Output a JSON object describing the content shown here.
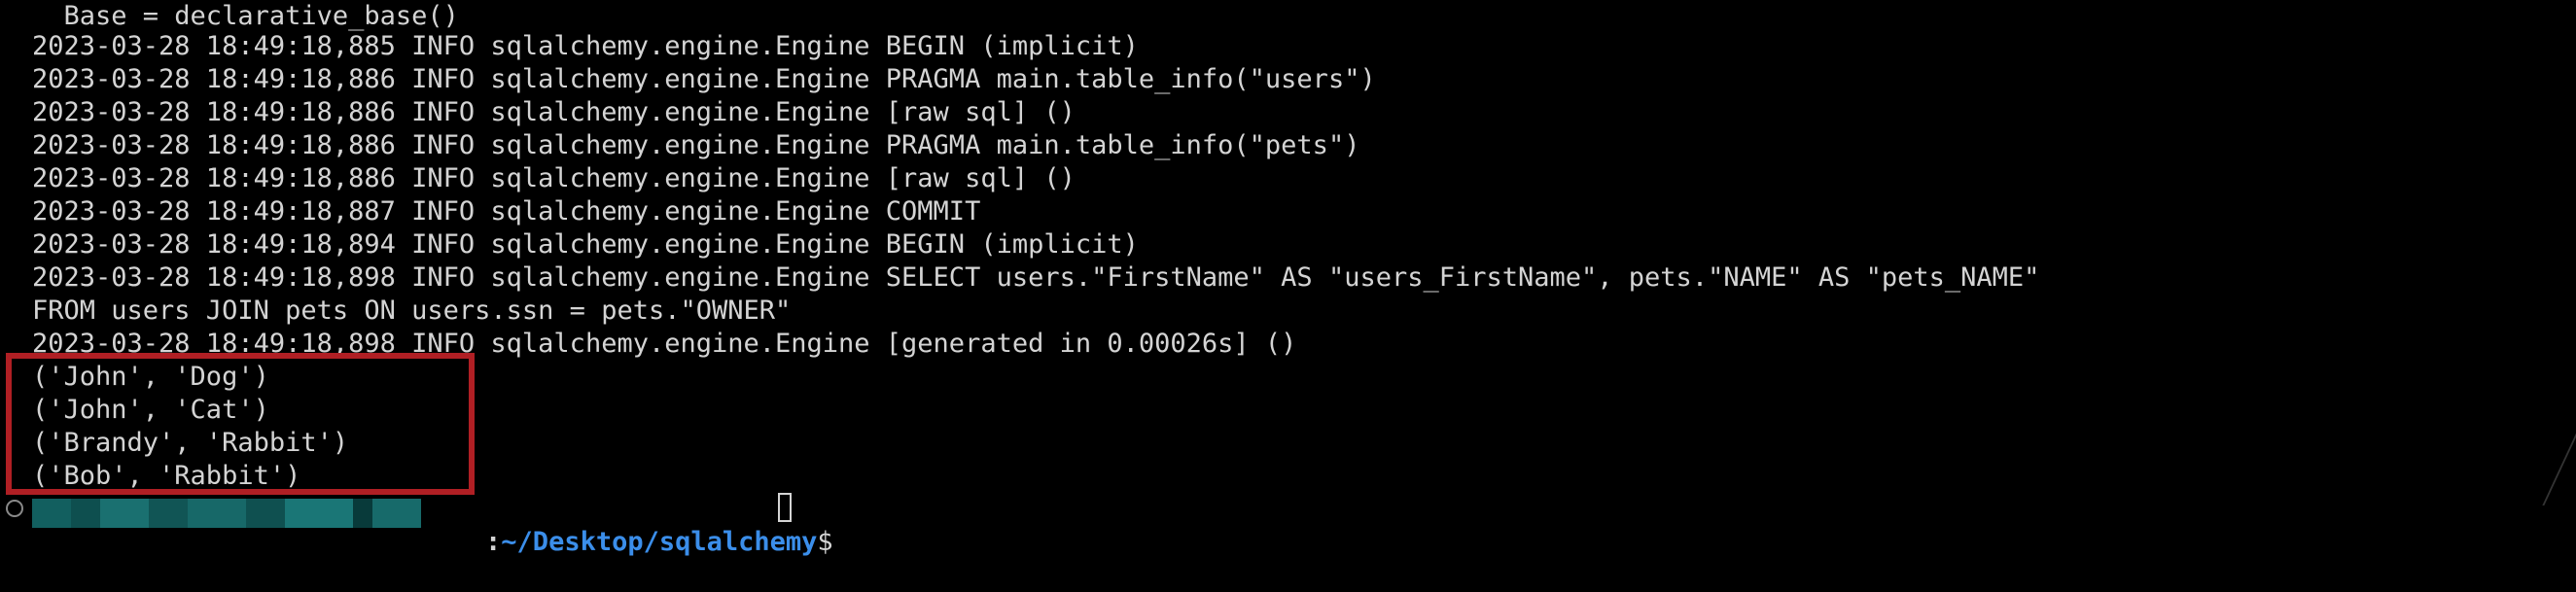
{
  "terminal": {
    "lines": [
      "  Base = declarative_base()",
      "2023-03-28 18:49:18,885 INFO sqlalchemy.engine.Engine BEGIN (implicit)",
      "2023-03-28 18:49:18,886 INFO sqlalchemy.engine.Engine PRAGMA main.table_info(\"users\")",
      "2023-03-28 18:49:18,886 INFO sqlalchemy.engine.Engine [raw sql] ()",
      "2023-03-28 18:49:18,886 INFO sqlalchemy.engine.Engine PRAGMA main.table_info(\"pets\")",
      "2023-03-28 18:49:18,886 INFO sqlalchemy.engine.Engine [raw sql] ()",
      "2023-03-28 18:49:18,887 INFO sqlalchemy.engine.Engine COMMIT",
      "2023-03-28 18:49:18,894 INFO sqlalchemy.engine.Engine BEGIN (implicit)",
      "2023-03-28 18:49:18,898 INFO sqlalchemy.engine.Engine SELECT users.\"FirstName\" AS \"users_FirstName\", pets.\"NAME\" AS \"pets_NAME\"",
      "FROM users JOIN pets ON users.ssn = pets.\"OWNER\"",
      "2023-03-28 18:49:18,898 INFO sqlalchemy.engine.Engine [generated in 0.00026s] ()",
      "('John', 'Dog')",
      "('John', 'Cat')",
      "('Brandy', 'Rabbit')",
      "('Bob', 'Rabbit')"
    ],
    "prompt": {
      "separator": ":",
      "path": "~/Desktop/sqlalchemy",
      "dollar": "$ "
    }
  },
  "colors": {
    "background": "#000000",
    "text": "#d4d4d4",
    "highlight_border": "#b01f24",
    "prompt_path": "#3b8eea",
    "redacted_block_dark": "#0f5f5f",
    "redacted_block_light": "#1a7a7a"
  }
}
